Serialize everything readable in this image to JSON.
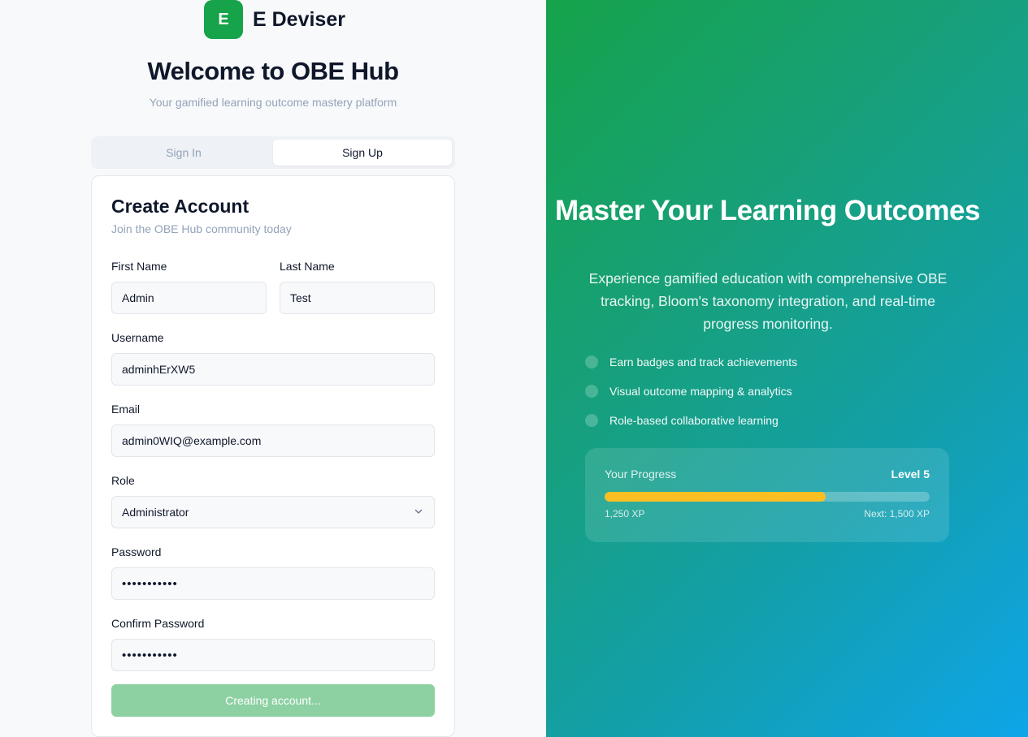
{
  "brand": {
    "logo_letter": "E",
    "name": "E Deviser",
    "accent": "#16a34a"
  },
  "welcome": {
    "title": "Welcome to OBE Hub",
    "tagline": "Your gamified learning outcome mastery platform"
  },
  "tabs": [
    {
      "label": "Sign In",
      "active": false
    },
    {
      "label": "Sign Up",
      "active": true
    }
  ],
  "form": {
    "title": "Create Account",
    "subtitle": "Join the OBE Hub community today",
    "first_name": {
      "label": "First Name",
      "value": "Admin"
    },
    "last_name": {
      "label": "Last Name",
      "value": "Test"
    },
    "username": {
      "label": "Username",
      "value": "adminhErXW5"
    },
    "email": {
      "label": "Email",
      "value": "admin0WIQ@example.com"
    },
    "role": {
      "label": "Role",
      "value": "Administrator"
    },
    "password": {
      "label": "Password",
      "value": "•••••••••••"
    },
    "confirm_password": {
      "label": "Confirm Password",
      "value": "•••••••••••"
    },
    "submit_label": "Creating account..."
  },
  "hero": {
    "title": "Master Your Learning Outcomes",
    "description": "Experience gamified education with comprehensive OBE tracking, Bloom's taxonomy integration, and real-time progress monitoring.",
    "features": [
      "Earn badges and track achievements",
      "Visual outcome mapping & analytics",
      "Role-based collaborative learning"
    ],
    "progress": {
      "label": "Your Progress",
      "level": "Level 5",
      "current": "1,250 XP",
      "next": "Next: 1,500 XP",
      "fraction": 0.68,
      "bar_color": "#fbbf24"
    }
  }
}
